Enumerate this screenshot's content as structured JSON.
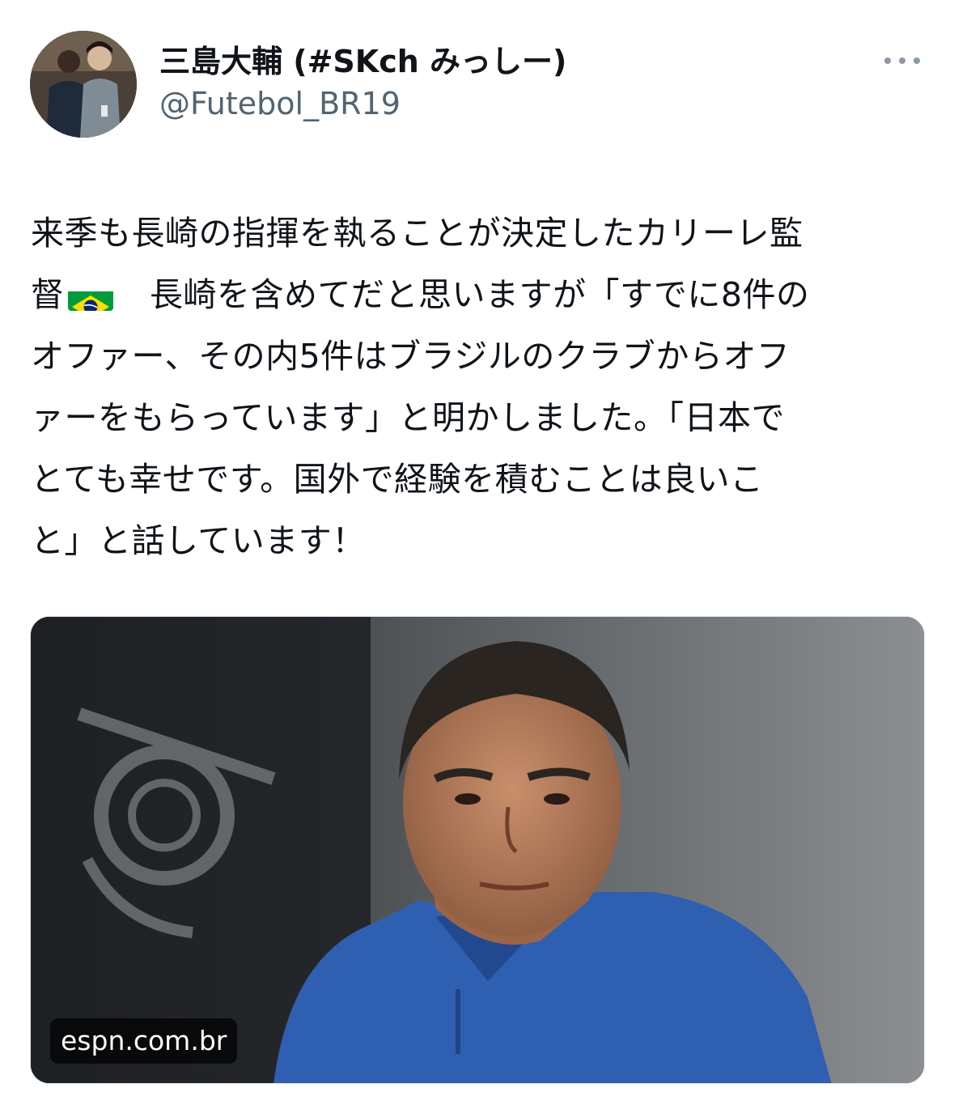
{
  "tweet": {
    "author": {
      "display_name": "三島大輔 (#SKch みっしー)",
      "handle": "@Futebol_BR19",
      "avatar": "avatar-photo"
    },
    "text_lines": [
      "来季も長崎の指揮を執ることが決定したカリーレ監",
      "長崎を含めてだと思いますが「すでに8件の",
      "オファー、その内5件はブラジルのクラブからオフ",
      "ァーをもらっています」と明かしました。「日本で",
      "とても幸せです。国外で経験を積むことは良いこ",
      "と」と話しています！"
    ],
    "line2_prefix": "督",
    "emoji": "brazil-flag",
    "more_icon": "more-horizontal-icon",
    "media": {
      "description_icon": "photo",
      "source": "espn.com.br"
    }
  },
  "colors": {
    "text": "#0f1419",
    "secondary": "#536471",
    "flag_green": "#009c3b",
    "flag_yellow": "#ffdf00",
    "flag_blue": "#002776",
    "shirt_blue": "#2f5fb0"
  }
}
